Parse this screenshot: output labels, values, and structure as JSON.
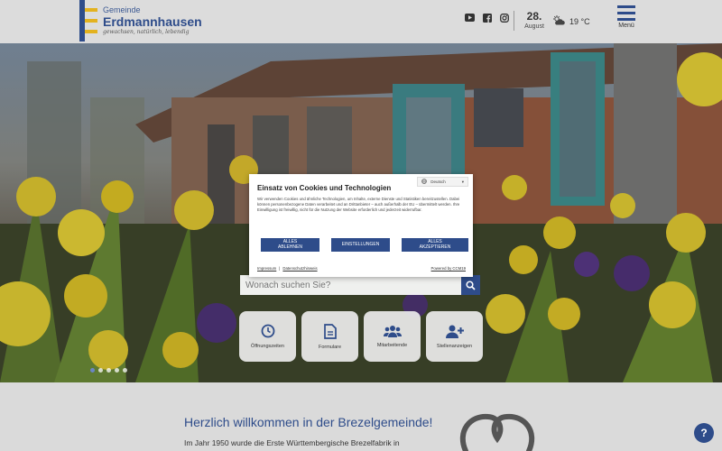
{
  "header": {
    "logo": {
      "small": "Gemeinde",
      "big": "Erdmannhausen",
      "tagline": "gewachsen, natürlich, lebendig"
    },
    "socials": [
      {
        "icon": "youtube-icon"
      },
      {
        "icon": "facebook-icon"
      },
      {
        "icon": "instagram-icon"
      }
    ],
    "date": {
      "day": "28.",
      "month": "August"
    },
    "weather": {
      "icon": "partly-cloudy-icon",
      "temp": "19 °C"
    },
    "menu_label": "Menü"
  },
  "search": {
    "placeholder": "Wonach suchen Sie?"
  },
  "tiles": [
    {
      "icon": "clock-icon",
      "label": "Öffnungszeiten"
    },
    {
      "icon": "document-icon",
      "label": "Formulare"
    },
    {
      "icon": "people-icon",
      "label": "Mitarbeitende"
    },
    {
      "icon": "user-plus-icon",
      "label": "Stellenanzeigen"
    }
  ],
  "slider": {
    "count": 5,
    "active": 0
  },
  "content": {
    "title": "Herzlich willkommen in der Brezelgemeinde!",
    "text": "Im Jahr 1950 wurde die Erste Württembergische Brezelfabrik in"
  },
  "cookie": {
    "language": "Deutsch",
    "title": "Einsatz von Cookies und Technologien",
    "text": "Wir verwenden Cookies und ähnliche Technologien, um Inhalte, externe Dienste und Statistiken bereitzustellen. Dabei können personenbezogene Daten verarbeitet und an Drittanbieter – auch außerhalb der EU – übermittelt werden. Ihre Einwilligung ist freiwillig, nicht für die Nutzung der Website erforderlich und jederzeit widerrufbar.",
    "btn_reject_1": "ALLES",
    "btn_reject_2": "ABLEHNEN",
    "btn_settings": "EINSTELLUNGEN",
    "btn_accept_1": "ALLES",
    "btn_accept_2": "AKZEPTIEREN",
    "link_imprint": "Impressum",
    "link_sep": "|",
    "link_privacy": "Datenschutzhinweis",
    "powered": "Powered by CCM19"
  },
  "help_label": "?",
  "colors": {
    "brand": "#2e4c8a",
    "accent": "#e3b21f"
  }
}
